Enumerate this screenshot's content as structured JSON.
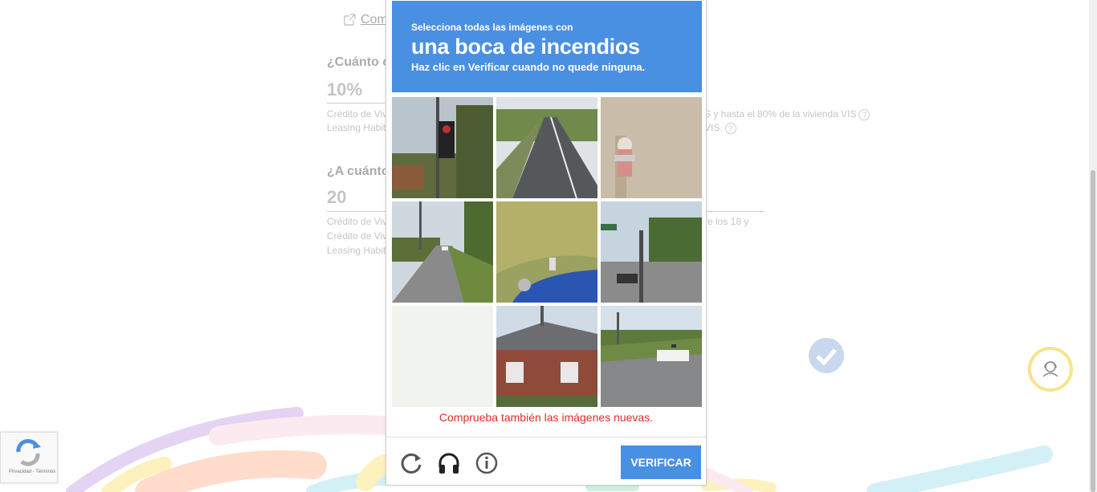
{
  "background": {
    "link_text": "Com",
    "q1": "¿Cuánto c",
    "q1_value": "10%",
    "q1_note1_left": "Crédito de Viv",
    "q1_note1_right": "S y hasta el 80% de la vivienda VIS",
    "q1_note2_left": "Leasing Habit",
    "q1_note2_right": "VIS.",
    "q2": "¿A cuánto",
    "q2_value": "20",
    "q2_note1_left": "Crédito de Viv",
    "q2_note1_right": "re los 18 y",
    "q2_note2_left": "Crédito de Viv",
    "q2_note3_left": "Leasing Habit",
    "qmark": "?"
  },
  "captcha": {
    "instruction_line1": "Selecciona todas las imágenes con",
    "target": "una boca de incendios",
    "instruction_line3": "Haz clic en Verificar cuando no quede ninguna.",
    "error": "Comprueba también las imágenes nuevas.",
    "verify_label": "VERIFICAR",
    "tiles": [
      "traffic-light",
      "road",
      "fire-hydrant",
      "road-car",
      "grass-car",
      "street-sign",
      "selected-blank",
      "house",
      "intersection-car"
    ]
  },
  "recaptcha": {
    "terms": "Privacidad - Términos"
  },
  "colors": {
    "header": "#4a90e2",
    "error": "#d93025",
    "help_ring": "#f8e38a"
  }
}
